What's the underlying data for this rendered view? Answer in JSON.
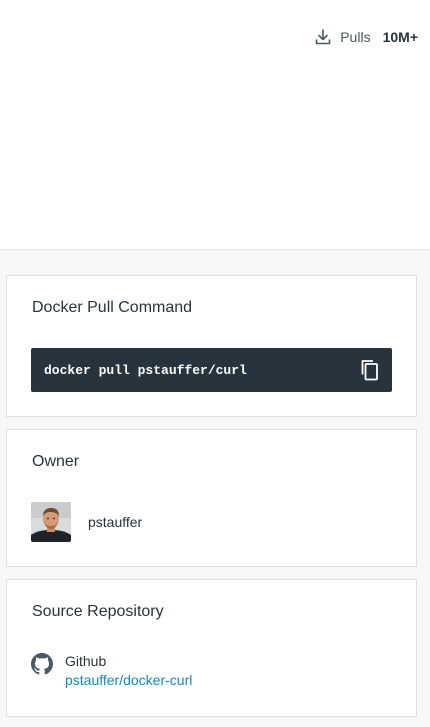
{
  "header": {
    "pulls_label": "Pulls",
    "pulls_count": "10M+"
  },
  "pull_command": {
    "title": "Docker Pull Command",
    "command": "docker pull pstauffer/curl"
  },
  "owner": {
    "title": "Owner",
    "name": "pstauffer"
  },
  "source_repository": {
    "title": "Source Repository",
    "provider": "Github",
    "repo": "pstauffer/docker-curl"
  },
  "colors": {
    "command_bg": "#27343d",
    "link": "#1488c6",
    "page_bg": "#f6f7f8"
  },
  "icons": {
    "download": "download-icon",
    "copy": "copy-icon",
    "github": "github-icon"
  }
}
